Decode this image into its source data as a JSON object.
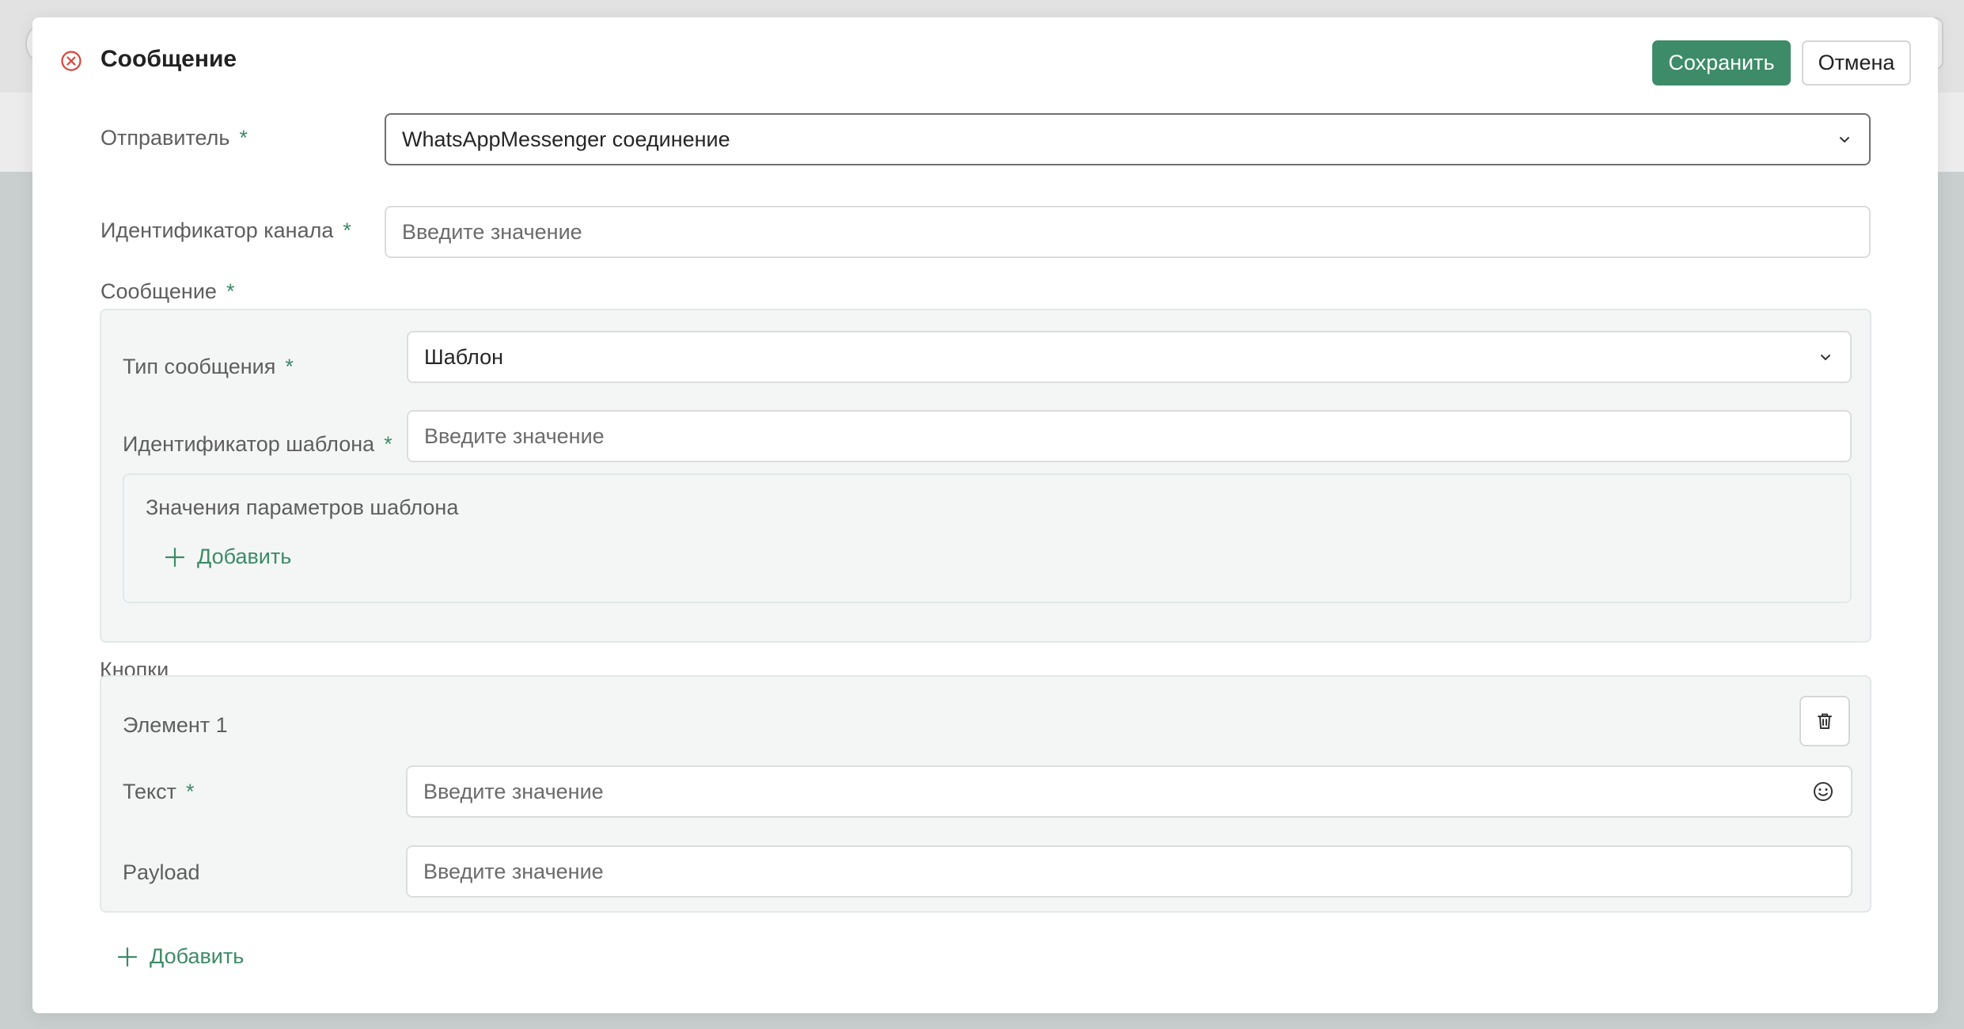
{
  "modal": {
    "title": "Сообщение",
    "save_label": "Сохранить",
    "cancel_label": "Отмена"
  },
  "form": {
    "sender": {
      "label": "Отправитель",
      "required": "*",
      "value": "WhatsAppMessenger соединение"
    },
    "channel_id": {
      "label": "Идентификатор канала",
      "required": "*",
      "placeholder": "Введите значение"
    },
    "message": {
      "label": "Сообщение",
      "required": "*",
      "message_type": {
        "label": "Тип сообщения",
        "required": "*",
        "value": "Шаблон"
      },
      "template_id": {
        "label": "Идентификатор шаблона",
        "required": "*",
        "placeholder": "Введите значение"
      },
      "template_params": {
        "label": "Значения параметров шаблона",
        "add_label": "Добавить"
      }
    },
    "buttons": {
      "label": "Кнопки",
      "items": [
        {
          "title": "Элемент 1",
          "text": {
            "label": "Текст",
            "required": "*",
            "placeholder": "Введите значение"
          },
          "payload": {
            "label": "Payload",
            "placeholder": "Введите значение"
          }
        }
      ],
      "add_label": "Добавить"
    }
  },
  "colors": {
    "accent": "#3d8b68",
    "close_icon": "#d9453a",
    "group_bg": "#f4f6f6"
  },
  "icons": {
    "close": "close-circle-icon",
    "dropdown": "chevron-down-icon",
    "add": "plus-icon",
    "delete": "trash-icon",
    "emoji": "emoji-icon"
  }
}
